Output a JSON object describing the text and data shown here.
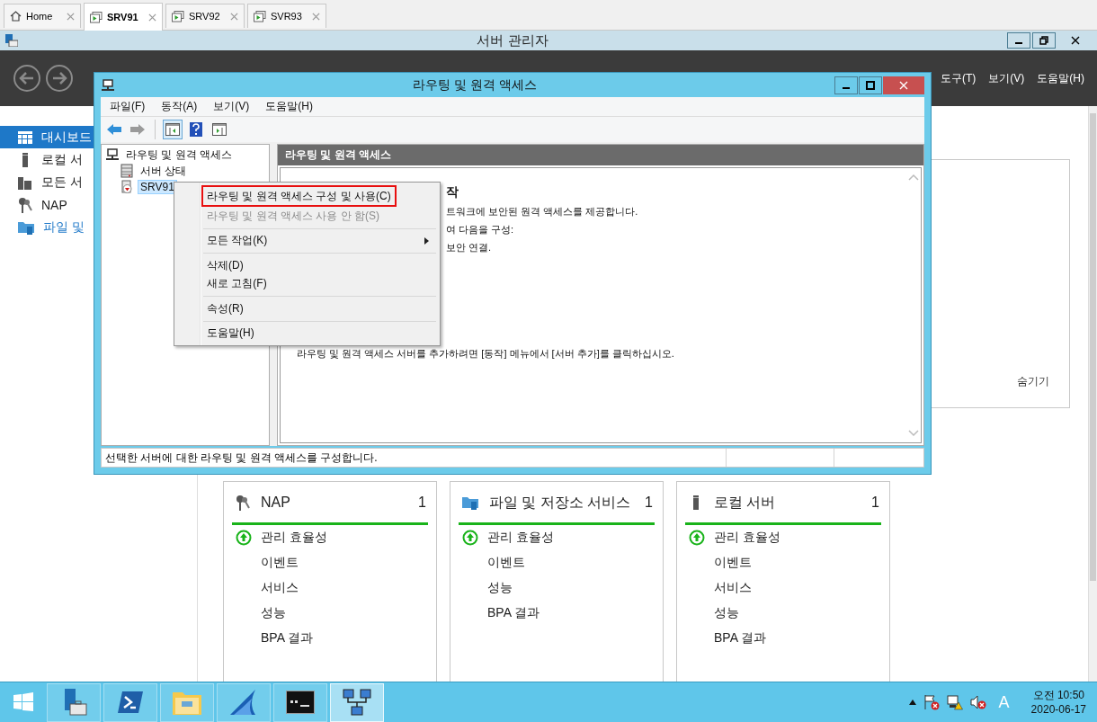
{
  "browser_tabs": [
    {
      "label": "Home",
      "kind": "home",
      "selected": false
    },
    {
      "label": "SRV91",
      "kind": "vm",
      "selected": true
    },
    {
      "label": "SRV92",
      "kind": "vm",
      "selected": false
    },
    {
      "label": "SVR93",
      "kind": "vm",
      "selected": false
    }
  ],
  "server_manager": {
    "title": "서버 관리자",
    "menu": [
      "도구(T)",
      "보기(V)",
      "도움말(H)"
    ],
    "sidebar": [
      {
        "label": "대시보드",
        "kind": "dashboard",
        "selected": true
      },
      {
        "label": "로컬 서",
        "kind": "server",
        "selected": false
      },
      {
        "label": "모든 서",
        "kind": "servers",
        "selected": false
      },
      {
        "label": "NAP",
        "kind": "key",
        "selected": false
      },
      {
        "label": "파일 및",
        "kind": "folder",
        "selected": false
      }
    ],
    "hide_link": "숨기기",
    "cards": [
      {
        "title": "NAP",
        "kind": "key",
        "count": "1",
        "rows": [
          {
            "label": "관리 효율성",
            "ok": true
          },
          {
            "label": "이벤트",
            "ok": false
          },
          {
            "label": "서비스",
            "ok": false
          },
          {
            "label": "성능",
            "ok": false
          },
          {
            "label": "BPA 결과",
            "ok": false
          }
        ]
      },
      {
        "title": "파일 및 저장소 서비스",
        "kind": "folder",
        "count": "1",
        "rows": [
          {
            "label": "관리 효율성",
            "ok": true
          },
          {
            "label": "이벤트",
            "ok": false
          },
          {
            "label": "성능",
            "ok": false
          },
          {
            "label": "BPA 결과",
            "ok": false
          }
        ]
      },
      {
        "title": "로컬 서버",
        "kind": "server",
        "count": "1",
        "rows": [
          {
            "label": "관리 효율성",
            "ok": true
          },
          {
            "label": "이벤트",
            "ok": false
          },
          {
            "label": "서비스",
            "ok": false
          },
          {
            "label": "성능",
            "ok": false
          },
          {
            "label": "BPA 결과",
            "ok": false
          }
        ]
      }
    ]
  },
  "mmc": {
    "title": "라우팅 및 원격 액세스",
    "menu": [
      "파일(F)",
      "동작(A)",
      "보기(V)",
      "도움말(H)"
    ],
    "toolbar": [
      {
        "kind": "back",
        "pressed": false
      },
      {
        "kind": "forward",
        "pressed": false
      },
      {
        "kind": "separator"
      },
      {
        "kind": "tree",
        "pressed": true
      },
      {
        "kind": "help",
        "pressed": false
      },
      {
        "kind": "panel",
        "pressed": false
      }
    ],
    "tree": [
      {
        "label": "라우팅 및 원격 액세스",
        "kind": "rras",
        "selected": false,
        "children": [
          {
            "label": "서버 상태",
            "kind": "status",
            "selected": false
          },
          {
            "label": "SRV91",
            "kind": "server",
            "selected": true
          }
        ]
      }
    ],
    "pane_title": "라우팅 및 원격 액세스",
    "content": [
      {
        "kind": "heading",
        "text": "작"
      },
      {
        "kind": "line",
        "text": "트워크에 보안된 원격 액세스를 제공합니다."
      },
      {
        "kind": "line",
        "text": "여 다음을 구성:"
      },
      {
        "kind": "line",
        "text": "보안 연결."
      },
      {
        "kind": "note",
        "text": "라우팅 및 원격 액세스 서버를 추가하려면 [동작] 메뉴에서 [서버 추가]를 클릭하십시오."
      }
    ],
    "status": "선택한 서버에 대한 라우팅 및 원격 액세스를 구성합니다."
  },
  "context_menu": [
    {
      "kind": "item",
      "label": "라우팅 및 원격 액세스 구성 및 사용(C)",
      "disabled": false,
      "marked": true
    },
    {
      "kind": "item",
      "label": "라우팅 및 원격 액세스 사용 안 함(S)",
      "disabled": true,
      "marked": false
    },
    {
      "kind": "separator"
    },
    {
      "kind": "submenu",
      "label": "모든 작업(K)",
      "disabled": false,
      "marked": false
    },
    {
      "kind": "separator"
    },
    {
      "kind": "item",
      "label": "삭제(D)",
      "disabled": false,
      "marked": false
    },
    {
      "kind": "item",
      "label": "새로 고침(F)",
      "disabled": false,
      "marked": false
    },
    {
      "kind": "separator"
    },
    {
      "kind": "item",
      "label": "속성(R)",
      "disabled": false,
      "marked": false
    },
    {
      "kind": "separator"
    },
    {
      "kind": "item",
      "label": "도움말(H)",
      "disabled": false,
      "marked": false
    }
  ],
  "taskbar": {
    "apps": [
      {
        "kind": "server-manager",
        "selected": false
      },
      {
        "kind": "powershell",
        "selected": false
      },
      {
        "kind": "explorer",
        "selected": false
      },
      {
        "kind": "shark",
        "selected": false
      },
      {
        "kind": "terminal",
        "selected": false
      },
      {
        "kind": "network",
        "selected": true
      }
    ],
    "tray": [
      {
        "kind": "chevron"
      },
      {
        "kind": "flag"
      },
      {
        "kind": "network"
      },
      {
        "kind": "speaker"
      }
    ],
    "ime": "A",
    "time": "오전 10:50",
    "date": "2020-06-17"
  }
}
